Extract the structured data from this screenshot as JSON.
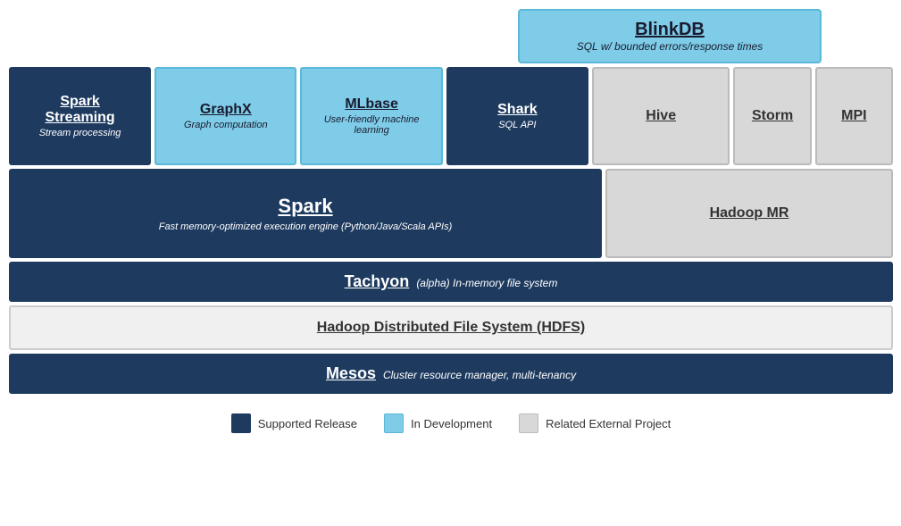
{
  "diagram": {
    "blinkdb": {
      "title": "BlinkDB",
      "subtitle": "SQL w/ bounded errors/response times"
    },
    "top_row": [
      {
        "id": "spark-streaming",
        "title": "Spark Streaming",
        "subtitle": "Stream processing",
        "style": "dark-blue"
      },
      {
        "id": "graphx",
        "title": "GraphX",
        "subtitle": "Graph computation",
        "style": "teal"
      },
      {
        "id": "mlbase",
        "title": "MLbase",
        "subtitle": "User-friendly machine learning",
        "style": "teal"
      },
      {
        "id": "shark",
        "title": "Shark",
        "subtitle": "SQL API",
        "style": "dark-blue"
      },
      {
        "id": "hive",
        "title": "Hive",
        "subtitle": "",
        "style": "light-gray"
      },
      {
        "id": "storm",
        "title": "Storm",
        "subtitle": "",
        "style": "light-gray"
      },
      {
        "id": "mpi",
        "title": "MPI",
        "subtitle": "",
        "style": "light-gray"
      }
    ],
    "spark": {
      "title": "Spark",
      "subtitle": "Fast memory-optimized execution engine (Python/Java/Scala APIs)"
    },
    "hadoop_mr": {
      "title": "Hadoop MR"
    },
    "tachyon": {
      "main": "Tachyon",
      "italic": "(alpha) In-memory file system"
    },
    "hdfs": {
      "main": "Hadoop Distributed File System (HDFS)"
    },
    "mesos": {
      "main": "Mesos",
      "italic": "Cluster resource manager, multi-tenancy"
    },
    "legend": {
      "items": [
        {
          "label": "Supported Release",
          "style": "dark"
        },
        {
          "label": "In Development",
          "style": "teal"
        },
        {
          "label": "Related External Project",
          "style": "gray"
        }
      ]
    }
  }
}
